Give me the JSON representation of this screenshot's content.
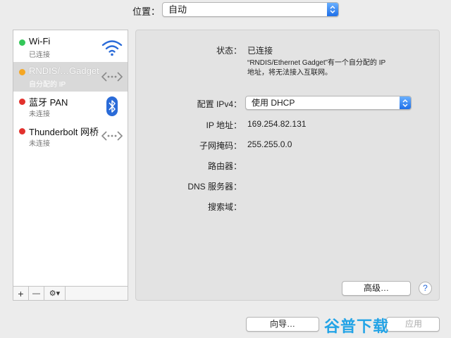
{
  "location": {
    "label": "位置：",
    "value": "自动"
  },
  "services": [
    {
      "name": "Wi-Fi",
      "status": "已连接",
      "color": "#34c759",
      "icon": "wifi-icon"
    },
    {
      "name": "RNDIS/…Gadget",
      "status": "自分配的 IP",
      "color": "#f5a623",
      "icon": "ethernet-icon"
    },
    {
      "name": "蓝牙 PAN",
      "status": "未连接",
      "color": "#e2312d",
      "icon": "bluetooth-icon"
    },
    {
      "name": "Thunderbolt 网桥",
      "status": "未连接",
      "color": "#e2312d",
      "icon": "ethernet-icon"
    }
  ],
  "toolbar": {
    "add": "+",
    "remove": "—",
    "action": "⚙▾"
  },
  "detail": {
    "status_label": "状态：",
    "status_value": "已连接",
    "description_line1": "“RNDIS/Ethernet Gadget”有一个自分配的 IP",
    "description_line2": "地址，将无法接入互联网。",
    "ipv4_label": "配置 IPv4：",
    "ipv4_value": "使用 DHCP",
    "ip_label": "IP 地址：",
    "ip_value": "169.254.82.131",
    "mask_label": "子网掩码：",
    "mask_value": "255.255.0.0",
    "router_label": "路由器：",
    "dns_label": "DNS 服务器：",
    "search_label": "搜索域："
  },
  "buttons": {
    "advanced": "高级…",
    "help": "?",
    "assist": "向导…",
    "apply": "应用"
  },
  "watermark": "谷普下载",
  "colors": {
    "accent": "#1e6fe8",
    "selected_row": "#d9d9d9"
  }
}
